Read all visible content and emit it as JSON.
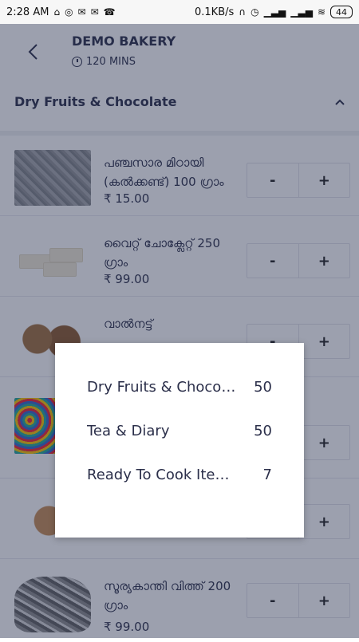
{
  "status_bar": {
    "time": "2:28 AM",
    "speed": "0.1KB/s",
    "battery": "44"
  },
  "header": {
    "title": "DEMO BAKERY",
    "subtitle": "120 MINS"
  },
  "section": {
    "title": "Dry Fruits & Chocolate"
  },
  "items": [
    {
      "name": "പഞ്ചസാര മിഠായി (കൽക്കണ്ട്) 100 ഗ്രാം",
      "price": "₹ 15.00"
    },
    {
      "name": "വൈറ്റ് ചോക്ലേറ്റ് 250 ഗ്രാം",
      "price": "₹ 99.00"
    },
    {
      "name": "വാൽനട്ട്",
      "price": ""
    },
    {
      "name": "",
      "price": ""
    },
    {
      "name": "",
      "price": ""
    },
    {
      "name": "സൂര്യകാന്തി വിത്ത് 200 ഗ്രാം",
      "price": "₹ 99.00"
    }
  ],
  "stepper": {
    "minus": "-",
    "plus": "+"
  },
  "dialog": {
    "rows": [
      {
        "label": "Dry Fruits & Chocol...",
        "count": "50"
      },
      {
        "label": "Tea & Diary",
        "count": "50"
      },
      {
        "label": "Ready To Cook Item...",
        "count": "7"
      }
    ]
  },
  "colors": {
    "text": "#2b2f4a",
    "overlay": "rgba(35,45,75,0.45)"
  },
  "icons": [
    "back-arrow-icon",
    "clock-icon",
    "chevron-up-icon",
    "whatsapp-icon",
    "mail-icon",
    "wifi-icon",
    "signal-icon",
    "alarm-icon",
    "headphones-icon"
  ]
}
